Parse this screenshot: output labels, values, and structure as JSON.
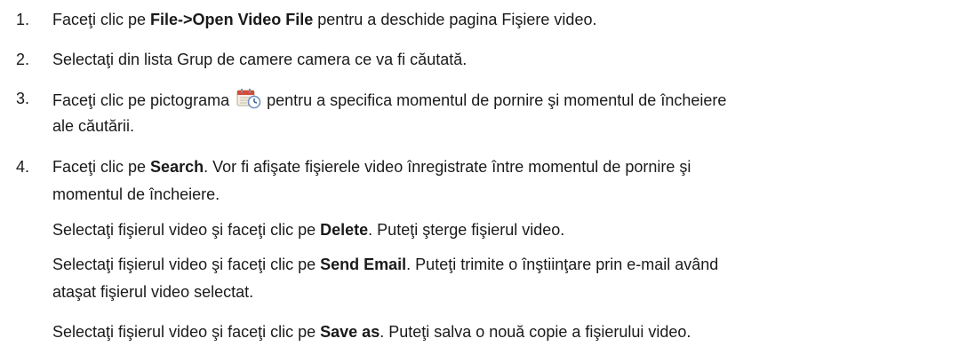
{
  "steps": [
    {
      "number": "1.",
      "text_a": "Faceţi clic pe ",
      "bold_a": "File->Open Video File",
      "text_b": " pentru a deschide pagina Fişiere video."
    },
    {
      "number": "2.",
      "text_a": "Selectaţi din lista Grup de camere camera ce va fi căutată."
    },
    {
      "number": "3.",
      "text_a": "Faceţi clic pe pictograma",
      "icon": "calendar-clock-icon",
      "text_b": "pentru a specifica momentul de pornire şi momentul de încheiere",
      "text_c": "ale căutării."
    },
    {
      "number": "4.",
      "text_a": "Faceţi clic pe ",
      "bold_a": "Search",
      "text_b": ". Vor fi afişate fişierele video înregistrate între momentul de pornire şi",
      "text_c": "momentul de încheiere."
    }
  ],
  "sub_notes": [
    {
      "text_a": "Selectaţi fişierul video şi faceţi clic pe ",
      "bold": "Delete",
      "text_b": ". Puteţi şterge fişierul video."
    },
    {
      "text_a": "Selectaţi fişierul video şi faceţi clic pe ",
      "bold": "Send Email",
      "text_b": ". Puteţi trimite o înştiinţare prin e-mail având",
      "text_c": "ataşat fişierul video selectat."
    },
    {
      "text_a": "Selectaţi fişierul video şi faceţi clic pe ",
      "bold": "Save as",
      "text_b": ". Puteţi salva o nouă copie a fişierului video."
    }
  ]
}
